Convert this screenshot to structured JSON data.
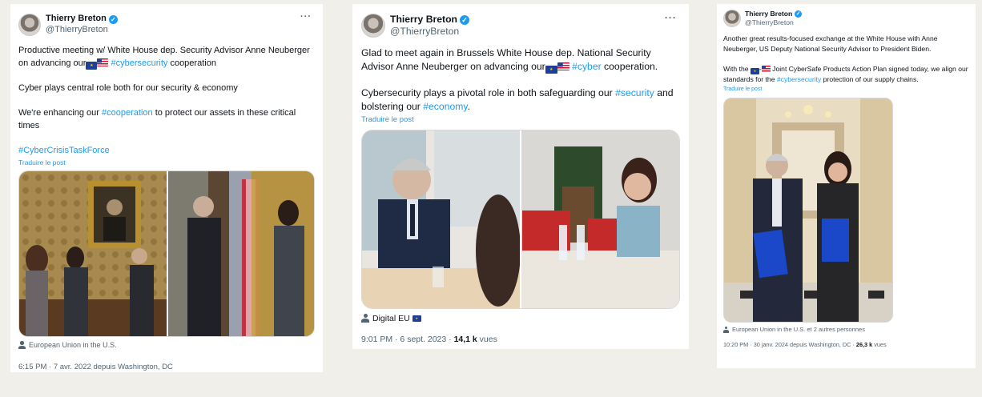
{
  "tweets": [
    {
      "name": "Thierry Breton",
      "handle": "@ThierryBreton",
      "more": "···",
      "text1a": "Productive meeting w/ White House dep. Security Advisor Anne Neuberger on advancing our",
      "text1_hashtag": "#cybersecurity",
      "text1b": " cooperation",
      "text2": "Cyber plays central role both for our security & economy",
      "text3a": "We're enhancing our ",
      "text3_hashtag": "#cooperation",
      "text3b": " to protect our assets in these critical times",
      "text4_hashtag": "#CyberCrisisTaskForce",
      "translate": "Traduire le post",
      "tagged": "European Union in the U.S.",
      "time": "6:15 PM · 7 avr. 2022 depuis Washington, DC"
    },
    {
      "name": "Thierry Breton",
      "handle": "@ThierryBreton",
      "more": "···",
      "text1a": "Glad to meet again in Brussels White House dep. National Security Advisor Anne Neuberger on advancing our",
      "text1_hashtag": "#cyber",
      "text1b": " cooperation.",
      "text2a": "Cybersecurity plays a pivotal role in both safeguarding our ",
      "text2_hashtag1": "#security",
      "text2b": " and bolstering our ",
      "text2_hashtag2": "#economy",
      "text2c": ".",
      "translate": "Traduire le post",
      "tagged": "Digital EU",
      "time": "9:01 PM · 6 sept. 2023 · ",
      "views_count": "14,1 k",
      "views_label": " vues"
    },
    {
      "name": "Thierry Breton",
      "handle": "@ThierryBreton",
      "more": "···",
      "text1": "Another great results-focused exchange at the White House with Anne Neuberger, US Deputy National Security Advisor to President Biden.",
      "text2a": "With the ",
      "text2_dash": "-",
      "text2b": " Joint CyberSafe Products Action Plan signed today, we align our standards for the ",
      "text2_hashtag": "#cybersecurity",
      "text2c": " protection of our supply chains.",
      "translate": "Traduire le post",
      "tagged": "European Union in the U.S. et 2 autres personnes",
      "time": "10:20 PM · 30 janv. 2024 depuis Washington, DC · ",
      "views_count": "26,3 k",
      "views_label": " vues"
    }
  ],
  "colors": {
    "link": "#1d9bf0",
    "muted": "#536471",
    "background": "#f0efea"
  },
  "icons": [
    "verified-badge-icon",
    "more-options-icon",
    "tagged-person-icon",
    "eu-flag-icon",
    "us-flag-icon"
  ]
}
